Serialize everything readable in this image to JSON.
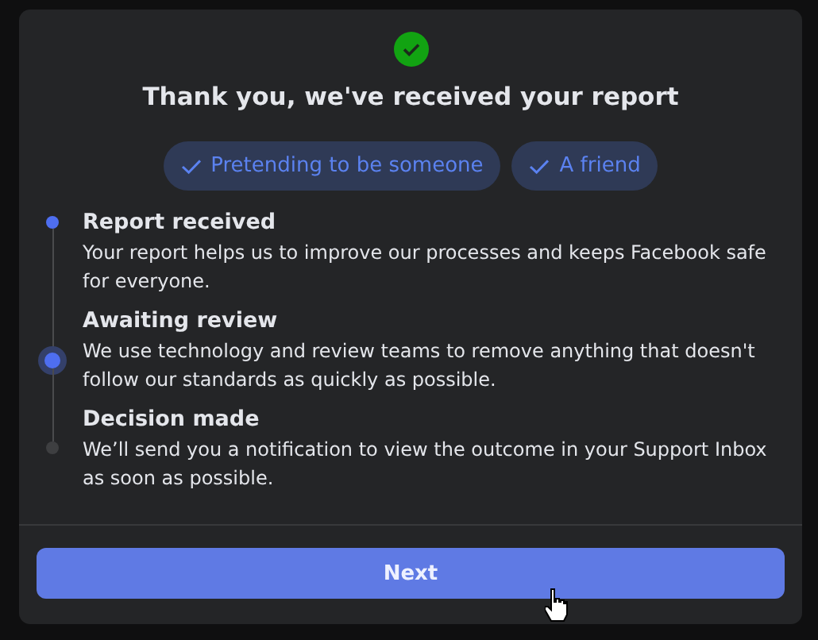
{
  "dialog": {
    "title": "Thank you, we've received your report",
    "tags": [
      {
        "label": "Pretending to be someone"
      },
      {
        "label": "A friend"
      }
    ],
    "steps": [
      {
        "title": "Report received",
        "description": "Your report helps us to improve our processes and keeps Facebook safe for everyone.",
        "kind": "done"
      },
      {
        "title": "Awaiting review",
        "description": "We use technology and review teams to remove anything that doesn't follow our standards as quickly as possible.",
        "kind": "current"
      },
      {
        "title": "Decision made",
        "description": "We’ll send you a notification to view the outcome in your Support Inbox as soon as possible.",
        "kind": "pending"
      }
    ],
    "button": "Next"
  }
}
